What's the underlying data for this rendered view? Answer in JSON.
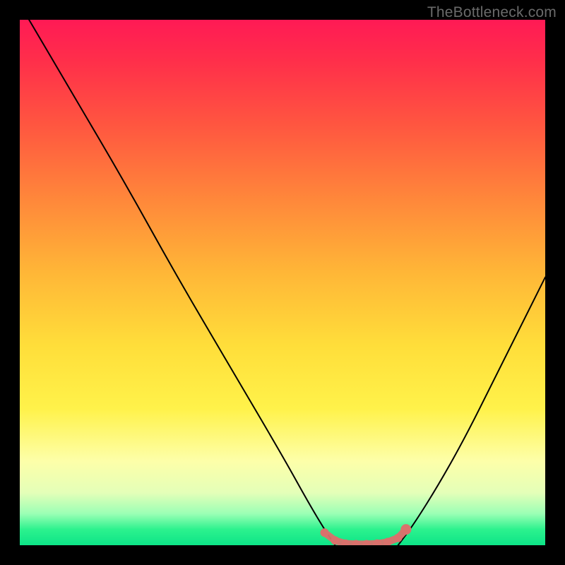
{
  "watermark": "TheBottleneck.com",
  "chart_data": {
    "type": "line",
    "title": "",
    "xlabel": "",
    "ylabel": "",
    "xlim": [
      0,
      100
    ],
    "ylim": [
      0,
      100
    ],
    "series": [
      {
        "name": "left-branch",
        "x": [
          0,
          10,
          20,
          30,
          40,
          50,
          55,
          58,
          60
        ],
        "y": [
          103,
          86,
          69,
          51,
          34,
          17,
          8,
          3,
          0
        ],
        "color": "#000000",
        "stroke_width": 2
      },
      {
        "name": "right-branch",
        "x": [
          72,
          75,
          80,
          85,
          90,
          95,
          100
        ],
        "y": [
          0,
          4,
          12,
          21,
          31,
          41,
          51
        ],
        "color": "#000000",
        "stroke_width": 2
      },
      {
        "name": "optimal-region",
        "x": [
          58,
          60,
          62,
          64,
          66,
          68,
          70,
          72,
          73.5
        ],
        "y": [
          2.4,
          0.9,
          0.3,
          0.2,
          0.2,
          0.3,
          0.6,
          1.4,
          3.0
        ],
        "color": "#d9716c",
        "stroke_width": 12,
        "dotted": true,
        "endpoint_dot": [
          73.5,
          3.0
        ]
      }
    ]
  }
}
